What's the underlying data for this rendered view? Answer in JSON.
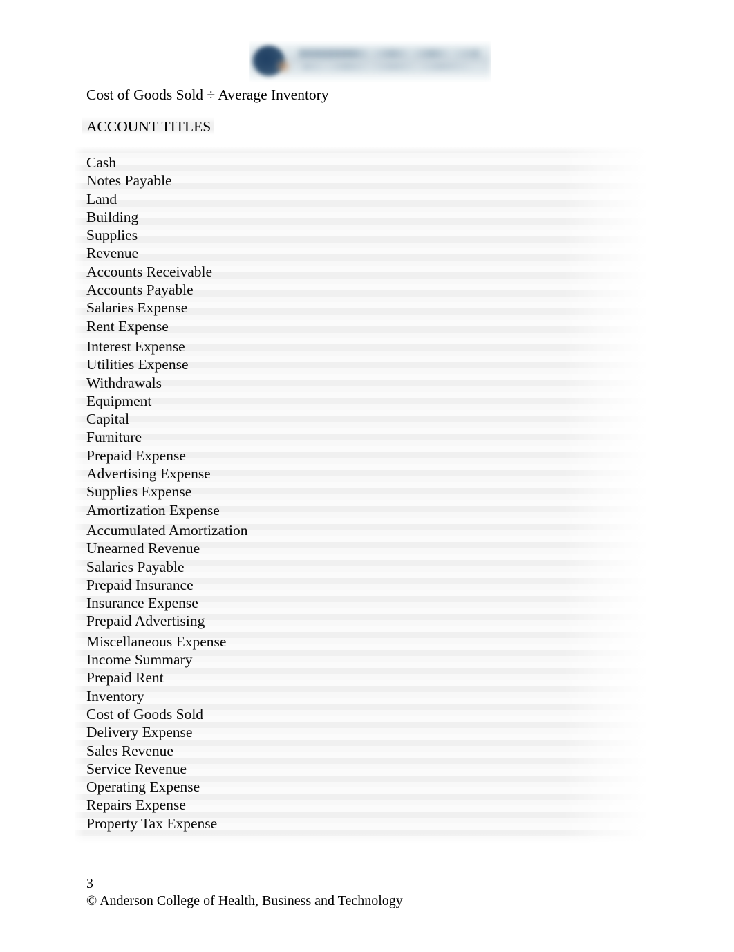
{
  "header": {
    "logo": {
      "icon": "college-seal-icon",
      "line1": "ANDERSON COLLEGE",
      "line2": "of Health, Business and Technology",
      "mark_color": "#2b4a6b",
      "band_color": "#ced9e0"
    }
  },
  "body": {
    "formula": "Cost of Goods Sold ÷ Average Inventory",
    "section_heading": "ACCOUNT TITLES"
  },
  "account_titles": [
    {
      "label": "Cash",
      "gap_before": false
    },
    {
      "label": "Notes Payable",
      "gap_before": false
    },
    {
      "label": "Land",
      "gap_before": false
    },
    {
      "label": "Building",
      "gap_before": false
    },
    {
      "label": "Supplies",
      "gap_before": false
    },
    {
      "label": "Revenue",
      "gap_before": false
    },
    {
      "label": "Accounts Receivable",
      "gap_before": false
    },
    {
      "label": "Accounts Payable",
      "gap_before": false
    },
    {
      "label": "Salaries Expense",
      "gap_before": false
    },
    {
      "label": "Rent Expense",
      "gap_before": false
    },
    {
      "label": "Interest Expense",
      "gap_before": true
    },
    {
      "label": "Utilities Expense",
      "gap_before": false
    },
    {
      "label": "Withdrawals",
      "gap_before": false
    },
    {
      "label": "Equipment",
      "gap_before": false
    },
    {
      "label": "Capital",
      "gap_before": false
    },
    {
      "label": "Furniture",
      "gap_before": false
    },
    {
      "label": "Prepaid Expense",
      "gap_before": false
    },
    {
      "label": "Advertising Expense",
      "gap_before": false
    },
    {
      "label": "Supplies Expense",
      "gap_before": false
    },
    {
      "label": "Amortization Expense",
      "gap_before": false
    },
    {
      "label": "Accumulated Amortization",
      "gap_before": true
    },
    {
      "label": "Unearned Revenue",
      "gap_before": false
    },
    {
      "label": "Salaries Payable",
      "gap_before": false
    },
    {
      "label": "Prepaid Insurance",
      "gap_before": false
    },
    {
      "label": "Insurance Expense",
      "gap_before": false
    },
    {
      "label": "Prepaid Advertising",
      "gap_before": false
    },
    {
      "label": "Miscellaneous Expense",
      "gap_before": true
    },
    {
      "label": "Income Summary",
      "gap_before": false
    },
    {
      "label": "Prepaid Rent",
      "gap_before": false
    },
    {
      "label": "Inventory",
      "gap_before": false
    },
    {
      "label": "Cost of Goods Sold",
      "gap_before": false
    },
    {
      "label": "Delivery Expense",
      "gap_before": false
    },
    {
      "label": "Sales Revenue",
      "gap_before": false
    },
    {
      "label": "Service Revenue",
      "gap_before": false
    },
    {
      "label": "Operating Expense",
      "gap_before": false
    },
    {
      "label": "Repairs Expense",
      "gap_before": false
    },
    {
      "label": "Property Tax Expense",
      "gap_before": false
    }
  ],
  "footer": {
    "page_number": "3",
    "copyright": "© Anderson College of Health, Business and Technology"
  }
}
